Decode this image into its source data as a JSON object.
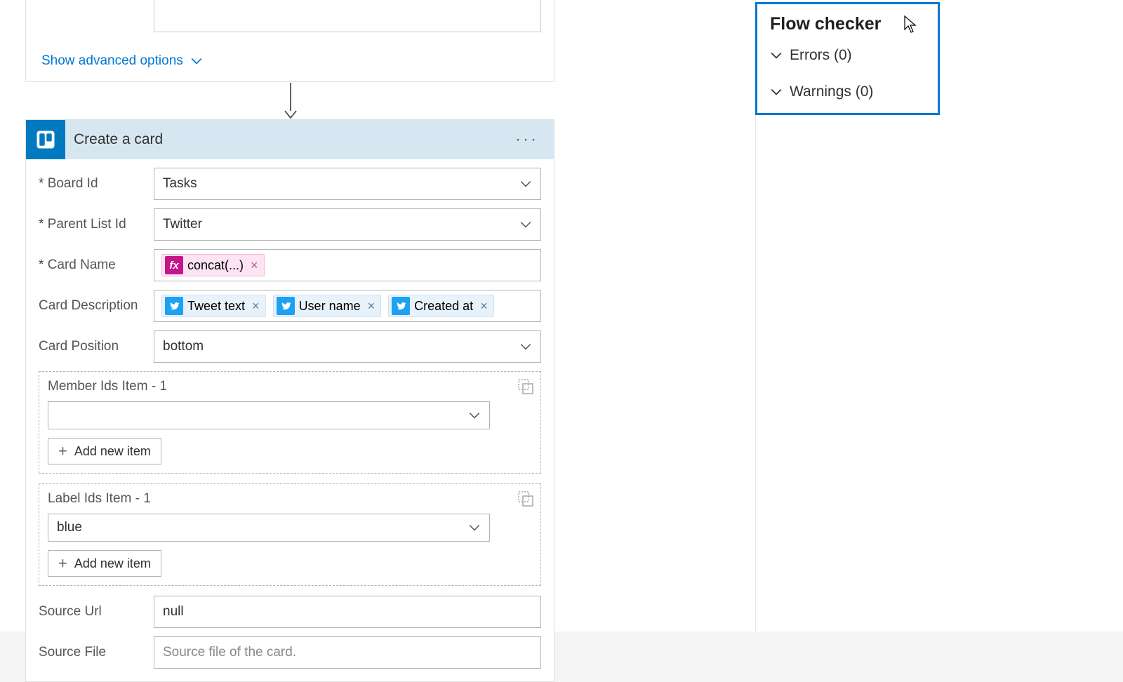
{
  "prev_card": {
    "advanced_label": "Show advanced options"
  },
  "action": {
    "title": "Create a card",
    "rows": {
      "board_id": {
        "label": "Board Id",
        "required": true,
        "value": "Tasks"
      },
      "parent_list_id": {
        "label": "Parent List Id",
        "required": true,
        "value": "Twitter"
      },
      "card_name": {
        "label": "Card Name",
        "required": true,
        "fx_token": "concat(...)"
      },
      "card_description": {
        "label": "Card Description",
        "tokens": [
          "Tweet text",
          "User name",
          "Created at"
        ]
      },
      "card_position": {
        "label": "Card Position",
        "value": "bottom"
      },
      "member_ids": {
        "title": "Member Ids Item - 1",
        "value": "",
        "add_label": "Add new item"
      },
      "label_ids": {
        "title": "Label Ids Item - 1",
        "value": "blue",
        "add_label": "Add new item"
      },
      "source_url": {
        "label": "Source Url",
        "value": "null"
      },
      "source_file": {
        "label": "Source File",
        "placeholder": "Source file of the card."
      }
    }
  },
  "flow_checker": {
    "title": "Flow checker",
    "errors_label": "Errors (0)",
    "warnings_label": "Warnings (0)"
  }
}
